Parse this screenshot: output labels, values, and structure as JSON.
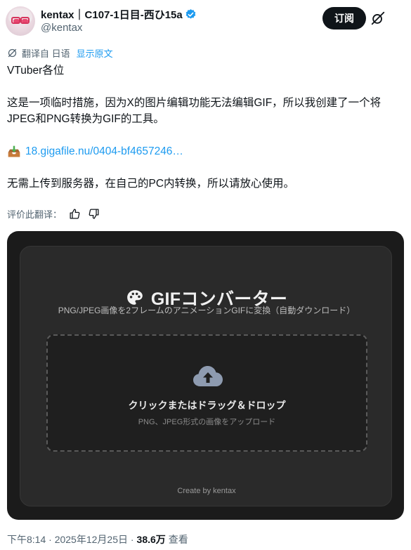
{
  "author": {
    "display_name": "kentax｜C107-1日目-西ひ15a",
    "handle": "@kentax",
    "verified_icon": "verified-badge-icon"
  },
  "actions": {
    "subscribe_label": "订阅",
    "grok_icon": "grok-icon"
  },
  "translation": {
    "translated_from": "翻译自 日语",
    "show_original": "显示原文"
  },
  "tweet": {
    "line1": "VTuber各位",
    "line2": "这是一项临时措施，因为X的图片编辑功能无法编辑GIF，所以我创建了一个将JPEG和PNG转换为GIF的工具。",
    "link_text": "18.gigafile.nu/0404-bf4657246…",
    "line3": "无需上传到服务器，在自己的PC内转换，所以请放心使用。"
  },
  "rate": {
    "label": "评价此翻译："
  },
  "media": {
    "title": "GIFコンバーター",
    "subtitle": "PNG/JPEG画像を2フレームのアニメーションGIFに変換（自動ダウンロード）",
    "drop_main": "クリックまたはドラッグ＆ドロップ",
    "drop_sub": "PNG、JPEG形式の画像をアップロード",
    "credit": "Create by kentax"
  },
  "meta": {
    "timestamp": "下午8:14 · 2025年12月25日 ·",
    "views_count": "38.6万",
    "views_label": "查看"
  },
  "colors": {
    "accent": "#1d9bf0",
    "text": "#0f1419",
    "muted": "#536471",
    "media_bg": "#1b1b1b",
    "card_bg": "#2a2a2a"
  }
}
